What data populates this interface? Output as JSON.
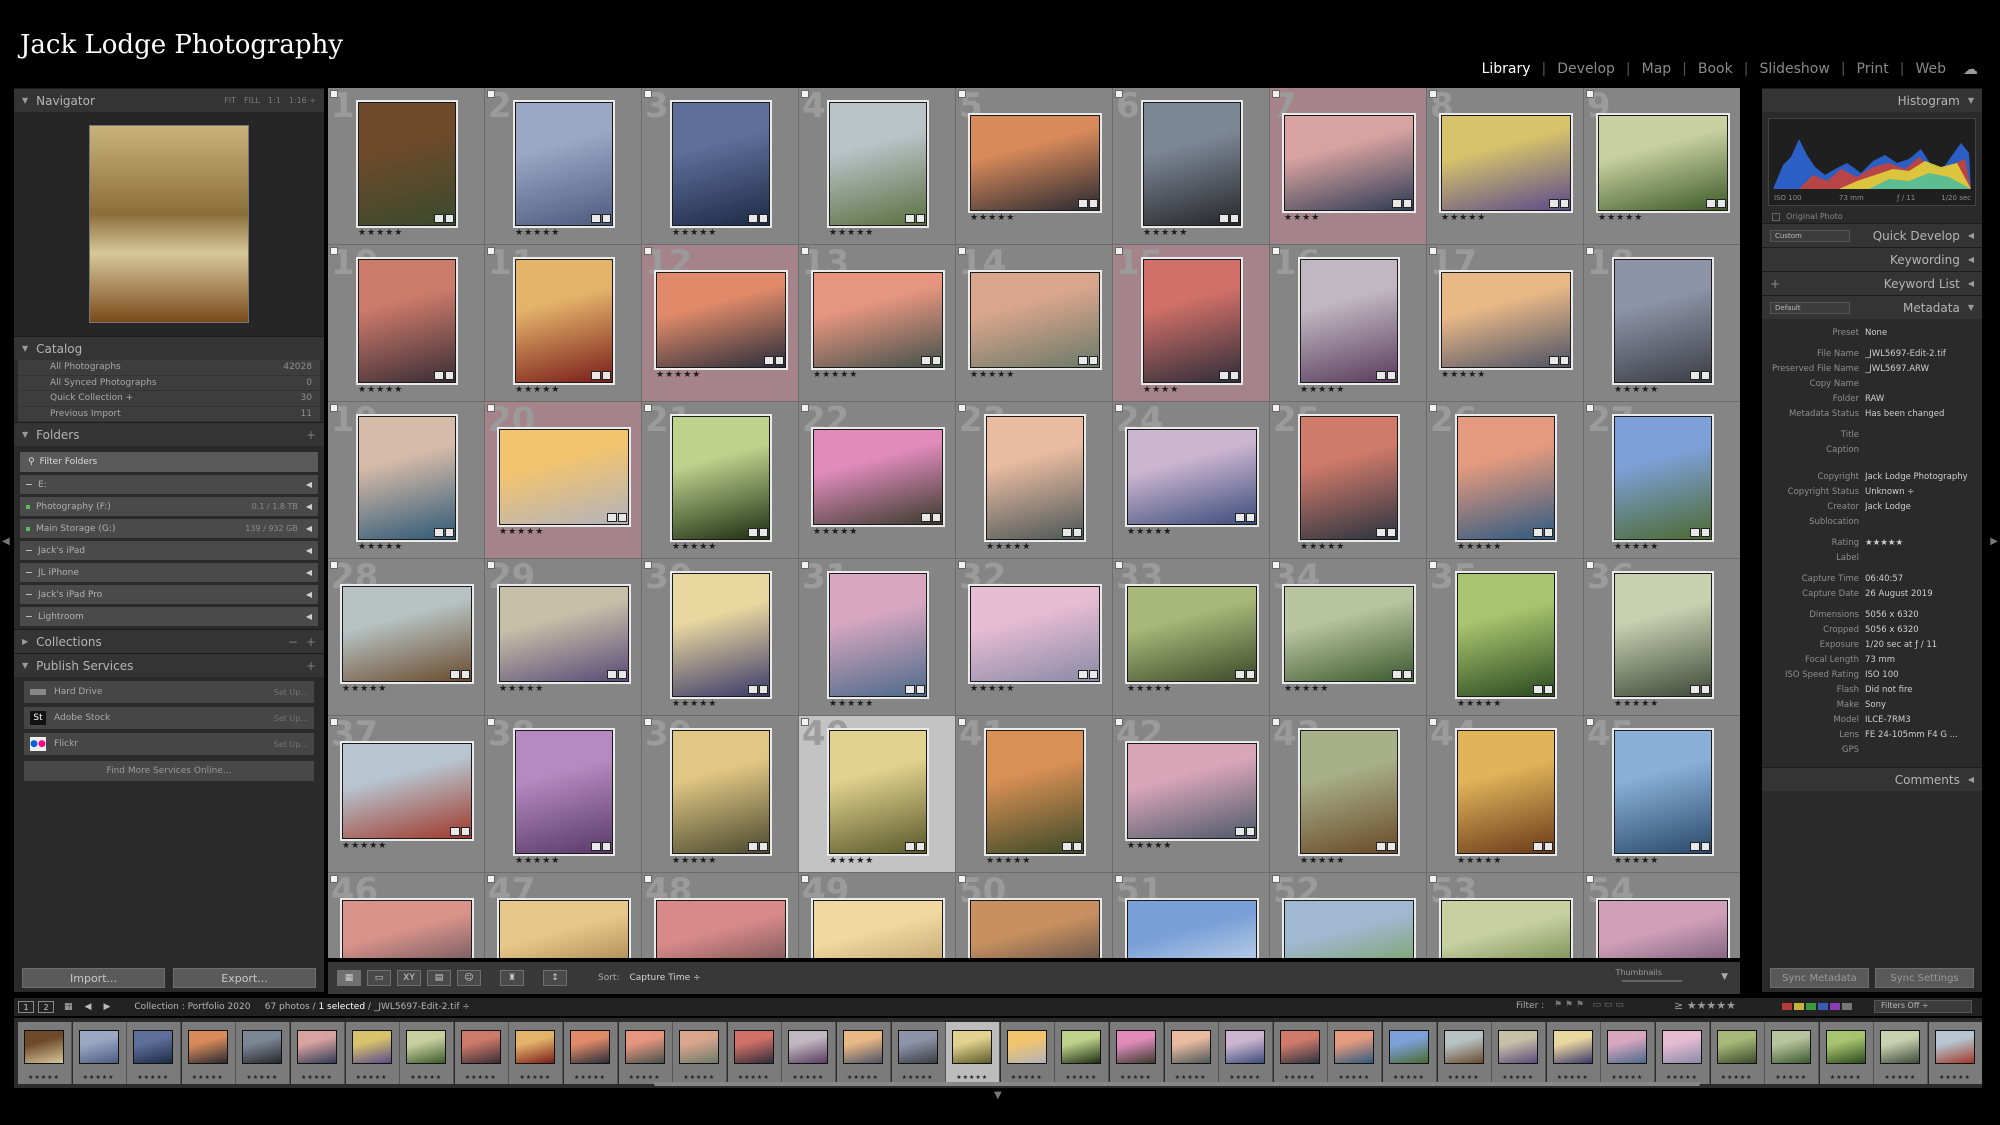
{
  "app": {
    "brand": "Jack Lodge Photography",
    "modules": [
      "Library",
      "Develop",
      "Map",
      "Book",
      "Slideshow",
      "Print",
      "Web"
    ],
    "active_module": "Library"
  },
  "left": {
    "navigator": {
      "title": "Navigator",
      "controls": [
        "FIT",
        "FILL",
        "1:1",
        "1:16 ÷"
      ]
    },
    "catalog": {
      "title": "Catalog",
      "items": [
        {
          "name": "All Photographs",
          "count": "42028"
        },
        {
          "name": "All Synced Photographs",
          "count": "0"
        },
        {
          "name": "Quick Collection +",
          "count": "30"
        },
        {
          "name": "Previous Import",
          "count": "11"
        }
      ]
    },
    "folders": {
      "title": "Folders",
      "filter_placeholder": "Filter Folders",
      "items": [
        {
          "name": "E:",
          "cap": ""
        },
        {
          "name": "Photography (F:)",
          "cap": "0.1 / 1.8 TB"
        },
        {
          "name": "Main Storage (G:)",
          "cap": "139 / 932 GB"
        },
        {
          "name": "Jack's iPad",
          "cap": ""
        },
        {
          "name": "JL iPhone",
          "cap": ""
        },
        {
          "name": "Jack's iPad Pro",
          "cap": ""
        },
        {
          "name": "Lightroom",
          "cap": ""
        }
      ]
    },
    "collections": {
      "title": "Collections"
    },
    "publish": {
      "title": "Publish Services",
      "items": [
        {
          "name": "Hard Drive",
          "setup": "Set Up..."
        },
        {
          "name": "Adobe Stock",
          "setup": "Set Up..."
        },
        {
          "name": "Flickr",
          "setup": "Set Up..."
        }
      ],
      "find_more": "Find More Services Online..."
    },
    "import_label": "Import...",
    "export_label": "Export..."
  },
  "toolbar": {
    "sort_label": "Sort:",
    "sort_value": "Capture Time ÷",
    "thumbnails_label": "Thumbnails"
  },
  "right": {
    "histogram": {
      "title": "Histogram",
      "iso": "ISO 100",
      "focal": "73 mm",
      "aperture": "ƒ / 11",
      "shutter": "1/20 sec",
      "original_photo": "Original Photo"
    },
    "quick_develop": {
      "title": "Quick Develop",
      "preset": "Custom"
    },
    "keywording": {
      "title": "Keywording"
    },
    "keyword_list": {
      "title": "Keyword List"
    },
    "metadata": {
      "title": "Metadata",
      "preset_dropdown": "Default",
      "fields": [
        {
          "k": "Preset",
          "v": "None"
        },
        {
          "k": "",
          "v": ""
        },
        {
          "k": "File Name",
          "v": "_JWL5697-Edit-2.tif"
        },
        {
          "k": "Preserved File Name",
          "v": "_JWL5697.ARW"
        },
        {
          "k": "Copy Name",
          "v": ""
        },
        {
          "k": "Folder",
          "v": "RAW"
        },
        {
          "k": "Metadata Status",
          "v": "Has been changed"
        },
        {
          "k": "",
          "v": ""
        },
        {
          "k": "Title",
          "v": ""
        },
        {
          "k": "Caption",
          "v": ""
        },
        {
          "k": "",
          "v": ""
        },
        {
          "k": "",
          "v": ""
        },
        {
          "k": "Copyright",
          "v": "Jack Lodge Photography"
        },
        {
          "k": "Copyright Status",
          "v": "Unknown ÷"
        },
        {
          "k": "Creator",
          "v": "Jack Lodge"
        },
        {
          "k": "Sublocation",
          "v": ""
        },
        {
          "k": "",
          "v": ""
        },
        {
          "k": "Rating",
          "v": "★★★★★"
        },
        {
          "k": "Label",
          "v": ""
        },
        {
          "k": "",
          "v": ""
        },
        {
          "k": "Capture Time",
          "v": "06:40:57"
        },
        {
          "k": "Capture Date",
          "v": "26 August 2019"
        },
        {
          "k": "",
          "v": ""
        },
        {
          "k": "Dimensions",
          "v": "5056 x 6320"
        },
        {
          "k": "Cropped",
          "v": "5056 x 6320"
        },
        {
          "k": "Exposure",
          "v": "1/20 sec at ƒ / 11"
        },
        {
          "k": "Focal Length",
          "v": "73 mm"
        },
        {
          "k": "ISO Speed Rating",
          "v": "ISO 100"
        },
        {
          "k": "Flash",
          "v": "Did not fire"
        },
        {
          "k": "Make",
          "v": "Sony"
        },
        {
          "k": "Model",
          "v": "ILCE-7RM3"
        },
        {
          "k": "Lens",
          "v": "FE 24-105mm F4 G ..."
        },
        {
          "k": "GPS",
          "v": ""
        }
      ]
    },
    "comments": {
      "title": "Comments"
    },
    "sync_metadata": "Sync Metadata",
    "sync_settings": "Sync Settings"
  },
  "filmstrip": {
    "collection": "Collection : Portfolio 2020",
    "count_text": "67 photos /",
    "selected_text": "1 selected",
    "file_text": "/ _JWL5697-Edit-2.tif ÷",
    "filter_label": "Filter :",
    "filters_off": "Filters Off ÷"
  },
  "grid": {
    "cells": [
      {
        "n": "1",
        "c": [
          "#6e4a2b",
          "#3b4a2d"
        ],
        "o": "p",
        "stars": "★★★★★"
      },
      {
        "n": "2",
        "c": [
          "#9aa8c4",
          "#4d5c80"
        ],
        "o": "p",
        "stars": "★★★★★"
      },
      {
        "n": "3",
        "c": [
          "#5d6f9a",
          "#1e2a45"
        ],
        "o": "p",
        "stars": "★★★★★"
      },
      {
        "n": "4",
        "c": [
          "#b9c3c8",
          "#5b7040"
        ],
        "o": "p",
        "stars": "★★★★★"
      },
      {
        "n": "5",
        "c": [
          "#d88a5a",
          "#2a2a32"
        ],
        "o": "l",
        "stars": "★★★★★"
      },
      {
        "n": "6",
        "c": [
          "#7c8796",
          "#27272a"
        ],
        "o": "p",
        "stars": "★★★★★"
      },
      {
        "n": "7",
        "c": [
          "#d7a2a0",
          "#2f3c55"
        ],
        "o": "l",
        "stars": "★★★★",
        "flag": true
      },
      {
        "n": "8",
        "c": [
          "#d7c36b",
          "#5a4a8a"
        ],
        "o": "l",
        "stars": "★★★★★"
      },
      {
        "n": "9",
        "c": [
          "#c9d0a0",
          "#3c5a2a"
        ],
        "o": "l",
        "stars": "★★★★★"
      },
      {
        "n": "10",
        "c": [
          "#cc7a6a",
          "#3b2e36"
        ],
        "o": "p",
        "stars": "★★★★★"
      },
      {
        "n": "11",
        "c": [
          "#e4b36a",
          "#7a1d1a"
        ],
        "o": "p",
        "stars": "★★★★★"
      },
      {
        "n": "12",
        "c": [
          "#e08a6a",
          "#2a2e3a"
        ],
        "o": "l",
        "stars": "★★★★★",
        "flag": true
      },
      {
        "n": "13",
        "c": [
          "#e6957f",
          "#44524c"
        ],
        "o": "l",
        "stars": "★★★★★"
      },
      {
        "n": "14",
        "c": [
          "#d9a58d",
          "#6b7a68"
        ],
        "o": "l",
        "stars": "★★★★★"
      },
      {
        "n": "15",
        "c": [
          "#d07068",
          "#302d3a"
        ],
        "o": "p",
        "stars": "★★★★",
        "flag": true
      },
      {
        "n": "16",
        "c": [
          "#c0b7c0",
          "#5a3c5e"
        ],
        "o": "p",
        "stars": "★★★★★"
      },
      {
        "n": "17",
        "c": [
          "#e9b887",
          "#4d5366"
        ],
        "o": "l",
        "stars": "★★★★★"
      },
      {
        "n": "18",
        "c": [
          "#8d93a8",
          "#3b3e44"
        ],
        "o": "p",
        "stars": "★★★★★"
      },
      {
        "n": "19",
        "c": [
          "#d6bba8",
          "#2e5a78"
        ],
        "o": "p",
        "stars": "★★★★★"
      },
      {
        "n": "20",
        "c": [
          "#f3c46e",
          "#b3b3bb"
        ],
        "o": "l",
        "stars": "★★★★★",
        "flag": true
      },
      {
        "n": "21",
        "c": [
          "#bfd28c",
          "#1e2e14"
        ],
        "o": "p",
        "stars": "★★★★★"
      },
      {
        "n": "22",
        "c": [
          "#e08bbb",
          "#3b3c2e"
        ],
        "o": "l",
        "stars": "★★★★★"
      },
      {
        "n": "23",
        "c": [
          "#e9bba1",
          "#4c5858"
        ],
        "o": "p",
        "stars": "★★★★★"
      },
      {
        "n": "24",
        "c": [
          "#cbb5d1",
          "#3c4d7a"
        ],
        "o": "l",
        "stars": "★★★★★"
      },
      {
        "n": "25",
        "c": [
          "#d07a6a",
          "#2b3440"
        ],
        "o": "p",
        "stars": "★★★★★"
      },
      {
        "n": "26",
        "c": [
          "#e39a7e",
          "#2e5a82"
        ],
        "o": "p",
        "stars": "★★★★★"
      },
      {
        "n": "27",
        "c": [
          "#7ea0d8",
          "#4c6a32"
        ],
        "o": "p",
        "stars": "★★★★★"
      },
      {
        "n": "28",
        "c": [
          "#b7c2c2",
          "#6a4b2e"
        ],
        "o": "l",
        "stars": "★★★★★"
      },
      {
        "n": "29",
        "c": [
          "#c6c0a8",
          "#5a4a78"
        ],
        "o": "l",
        "stars": "★★★★★"
      },
      {
        "n": "30",
        "c": [
          "#e9d7a0",
          "#3b3a6a"
        ],
        "o": "p",
        "stars": "★★★★★"
      },
      {
        "n": "31",
        "c": [
          "#d7a7c0",
          "#4c6a8a"
        ],
        "o": "p",
        "stars": "★★★★★"
      },
      {
        "n": "32",
        "c": [
          "#e6bcd2",
          "#8a8aa8"
        ],
        "o": "l",
        "stars": "★★★★★"
      },
      {
        "n": "33",
        "c": [
          "#a8b878",
          "#3b4a2a"
        ],
        "o": "l",
        "stars": "★★★★★"
      },
      {
        "n": "34",
        "c": [
          "#b8c3a0",
          "#3b5a30"
        ],
        "o": "l",
        "stars": "★★★★★"
      },
      {
        "n": "35",
        "c": [
          "#a7c46e",
          "#2a4a20"
        ],
        "o": "p",
        "stars": "★★★★★"
      },
      {
        "n": "36",
        "c": [
          "#c8d0b0",
          "#3d4a38"
        ],
        "o": "p",
        "stars": "★★★★★"
      },
      {
        "n": "37",
        "c": [
          "#b7c5d0",
          "#a0382a"
        ],
        "o": "l",
        "stars": "★★★★★"
      },
      {
        "n": "38",
        "c": [
          "#b58ac0",
          "#5a3a6a"
        ],
        "o": "p",
        "stars": "★★★★★"
      },
      {
        "n": "39",
        "c": [
          "#e0c784",
          "#4c4a30"
        ],
        "o": "p",
        "stars": "★★★★★"
      },
      {
        "n": "40",
        "c": [
          "#e2d28f",
          "#5a5a2a"
        ],
        "o": "p",
        "stars": "★★★★★",
        "sel": true
      },
      {
        "n": "41",
        "c": [
          "#d99054",
          "#3c4a28"
        ],
        "o": "p",
        "stars": "★★★★★"
      },
      {
        "n": "42",
        "c": [
          "#d9a6b8",
          "#4e5a6a"
        ],
        "o": "l",
        "stars": "★★★★★"
      },
      {
        "n": "43",
        "c": [
          "#a8b08a",
          "#6a4a2a"
        ],
        "o": "p",
        "stars": "★★★★★"
      },
      {
        "n": "44",
        "c": [
          "#e2b45a",
          "#6a3a1a"
        ],
        "o": "p",
        "stars": "★★★★★"
      },
      {
        "n": "45",
        "c": [
          "#8ab0d8",
          "#2a4a6a"
        ],
        "o": "p",
        "stars": "★★★★★"
      },
      {
        "n": "46",
        "c": [
          "#d8938a",
          "#3a3a48"
        ],
        "o": "l",
        "stars": ""
      },
      {
        "n": "47",
        "c": [
          "#e8c88a",
          "#8a6a3a"
        ],
        "o": "l",
        "stars": ""
      },
      {
        "n": "48",
        "c": [
          "#d88a8a",
          "#4a3a3a"
        ],
        "o": "l",
        "stars": ""
      },
      {
        "n": "49",
        "c": [
          "#f0d8a0",
          "#a88a5a"
        ],
        "o": "l",
        "stars": ""
      },
      {
        "n": "50",
        "c": [
          "#c89060",
          "#2a3040"
        ],
        "o": "l",
        "stars": ""
      },
      {
        "n": "51",
        "c": [
          "#7aa0d8",
          "#e0e8f0"
        ],
        "o": "l",
        "stars": ""
      },
      {
        "n": "52",
        "c": [
          "#a0b8d0",
          "#6a9a3a"
        ],
        "o": "l",
        "stars": ""
      },
      {
        "n": "53",
        "c": [
          "#c8d0a0",
          "#4a6a2a"
        ],
        "o": "l",
        "stars": ""
      },
      {
        "n": "54",
        "c": [
          "#d0a0b8",
          "#4a3a5a"
        ],
        "o": "l",
        "stars": ""
      }
    ]
  },
  "film_colors": [
    [
      "#6e4a2b",
      "#d8c89a"
    ],
    [
      "#9aa8c4",
      "#4d5c80"
    ],
    [
      "#5d6f9a",
      "#1e2a45"
    ],
    [
      "#d88a5a",
      "#2a2a32"
    ],
    [
      "#7c8796",
      "#27272a"
    ],
    [
      "#d7a2a0",
      "#2f3c55"
    ],
    [
      "#d7c36b",
      "#5a4a8a"
    ],
    [
      "#c9d0a0",
      "#3c5a2a"
    ],
    [
      "#cc7a6a",
      "#3b2e36"
    ],
    [
      "#e4b36a",
      "#7a1d1a"
    ],
    [
      "#e08a6a",
      "#2a2e3a"
    ],
    [
      "#e6957f",
      "#44524c"
    ],
    [
      "#d9a58d",
      "#6b7a68"
    ],
    [
      "#d07068",
      "#302d3a"
    ],
    [
      "#c0b7c0",
      "#5a3c5e"
    ],
    [
      "#e9b887",
      "#4d5366"
    ],
    [
      "#8d93a8",
      "#3b3e44"
    ],
    [
      "#e2d28f",
      "#5a5a2a"
    ],
    [
      "#f3c46e",
      "#b3b3bb"
    ],
    [
      "#bfd28c",
      "#1e2e14"
    ],
    [
      "#e08bbb",
      "#3b3c2e"
    ],
    [
      "#e9bba1",
      "#4c5858"
    ],
    [
      "#cbb5d1",
      "#3c4d7a"
    ],
    [
      "#d07a6a",
      "#2b3440"
    ],
    [
      "#e39a7e",
      "#2e5a82"
    ],
    [
      "#7ea0d8",
      "#4c6a32"
    ],
    [
      "#b7c2c2",
      "#6a4b2e"
    ],
    [
      "#c6c0a8",
      "#5a4a78"
    ],
    [
      "#e9d7a0",
      "#3b3a6a"
    ],
    [
      "#d7a7c0",
      "#4c6a8a"
    ],
    [
      "#e6bcd2",
      "#8a8aa8"
    ],
    [
      "#a8b878",
      "#3b4a2a"
    ],
    [
      "#b8c3a0",
      "#3b5a30"
    ],
    [
      "#a7c46e",
      "#2a4a20"
    ],
    [
      "#c8d0b0",
      "#3d4a38"
    ],
    [
      "#b7c5d0",
      "#a0382a"
    ]
  ]
}
